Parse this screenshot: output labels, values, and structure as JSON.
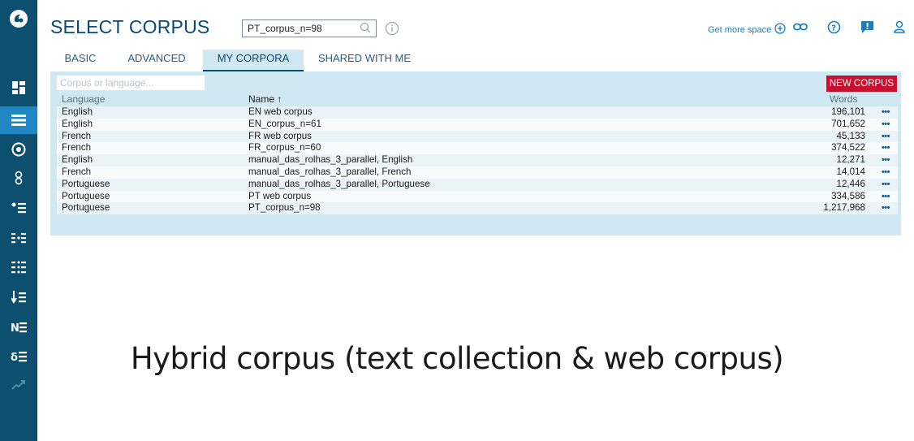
{
  "app": {
    "title": "SELECT CORPUS",
    "search": {
      "value": "PT_corpus_n=98",
      "placeholder": ""
    },
    "get_more_space": "Get more space"
  },
  "sidebar": {
    "items": [
      {
        "name": "logo",
        "glyph": "ᛗ"
      },
      {
        "name": "dashboard",
        "glyph": "▦"
      },
      {
        "name": "corpus",
        "glyph": "☰",
        "active": true
      },
      {
        "name": "concordance",
        "glyph": "⊙"
      },
      {
        "name": "word-sketch",
        "glyph": "8"
      },
      {
        "name": "thesaurus",
        "glyph": "•≡"
      },
      {
        "name": "sketch-diff",
        "glyph": "⁝⁝"
      },
      {
        "name": "wordlist",
        "glyph": "⁝⁝"
      },
      {
        "name": "keywords",
        "glyph": "↓≡"
      },
      {
        "name": "ngrams",
        "glyph": "N≡"
      },
      {
        "name": "trends",
        "glyph": "δ≡"
      },
      {
        "name": "ocd",
        "glyph": "↗"
      }
    ]
  },
  "tabs": [
    {
      "label": "BASIC"
    },
    {
      "label": "ADVANCED"
    },
    {
      "label": "MY CORPORA",
      "active": true
    },
    {
      "label": "SHARED WITH ME"
    }
  ],
  "table": {
    "filter_placeholder": "Corpus or language...",
    "new_corpus_label": "NEW CORPUS",
    "columns": {
      "language": "Language",
      "name": "Name ↑",
      "words": "Words"
    },
    "rows": [
      {
        "language": "English",
        "name": "EN web corpus",
        "words": "196,101"
      },
      {
        "language": "English",
        "name": "EN_corpus_n=61",
        "words": "701,652"
      },
      {
        "language": "French",
        "name": "FR web corpus",
        "words": "45,133"
      },
      {
        "language": "French",
        "name": "FR_corpus_n=60",
        "words": "374,522"
      },
      {
        "language": "English",
        "name": "manual_das_rolhas_3_parallel, English",
        "words": "12,271"
      },
      {
        "language": "French",
        "name": "manual_das_rolhas_3_parallel, French",
        "words": "14,014"
      },
      {
        "language": "Portuguese",
        "name": "manual_das_rolhas_3_parallel, Portuguese",
        "words": "12,446"
      },
      {
        "language": "Portuguese",
        "name": "PT web corpus",
        "words": "334,586"
      },
      {
        "language": "Portuguese",
        "name": "PT_corpus_n=98",
        "words": "1,217,968"
      }
    ],
    "row_menu": "•••"
  },
  "caption": "Hybrid corpus (text collection & web corpus)",
  "colors": {
    "sidebar": "#0d4f6e",
    "sidebar_active": "#1f87c4",
    "panel": "#cfe8f1",
    "accent_red": "#c8102e",
    "title": "#0a4a78"
  }
}
